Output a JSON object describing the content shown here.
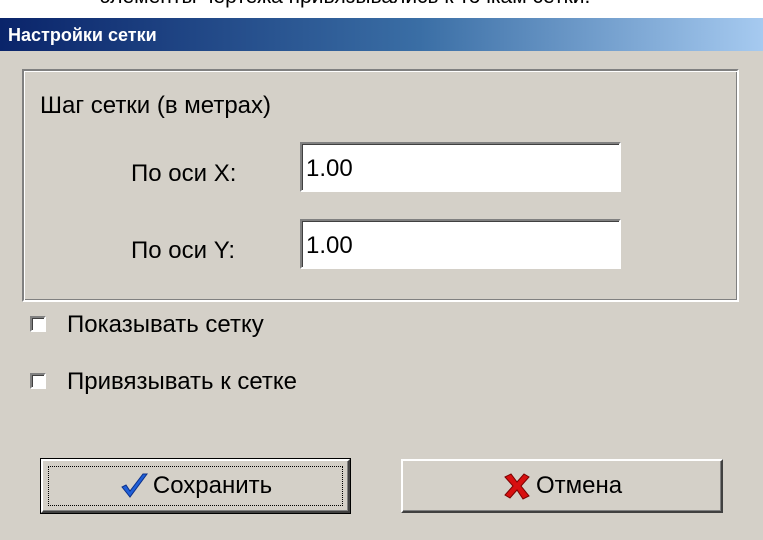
{
  "background_text": "элементы чертежа привязывались к точкам сетки.",
  "window": {
    "title": "Настройки сетки"
  },
  "grid_step": {
    "group_label": "Шаг сетки (в метрах)",
    "x_label": "По оси X:",
    "x_value": "1.00",
    "y_label": "По оси Y:",
    "y_value": "1.00"
  },
  "options": {
    "show_grid": {
      "label": "Показывать сетку",
      "checked": false
    },
    "snap_to_grid": {
      "label": "Привязывать к сетке",
      "checked": false
    }
  },
  "buttons": {
    "save": {
      "label": "Сохранить",
      "icon": "checkmark-icon"
    },
    "cancel": {
      "label": "Отмена",
      "icon": "cross-icon"
    }
  },
  "colors": {
    "title_gradient_start": "#0a246a",
    "title_gradient_end": "#a6caf0",
    "dialog_face": "#d4d0c8",
    "check_icon": "#1f5fd8",
    "cross_icon": "#d81010"
  }
}
